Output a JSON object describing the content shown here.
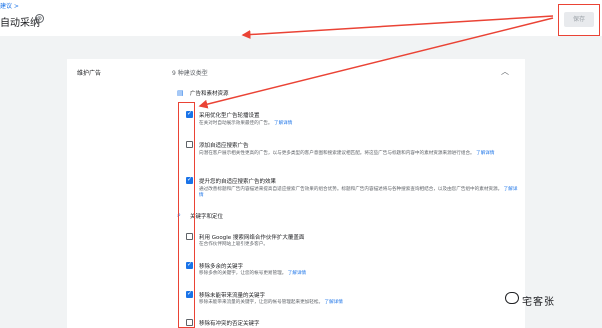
{
  "header": {
    "breadcrumb": "建议 >",
    "title": "自动采纳",
    "close_symbol": "⊗",
    "save_label": "保存"
  },
  "card": {
    "section_label": "维护广告",
    "count_label": "9 种建议类型"
  },
  "groups": [
    {
      "title": "广告和素材资源",
      "icon": "ads-icon"
    },
    {
      "title": "关键字和定位",
      "icon": "search-icon"
    }
  ],
  "items": [
    {
      "checked": true,
      "title": "采用优化型广告轮播设置",
      "desc": "在关对时自动展示效果最佳的广告。",
      "link": "了解详情"
    },
    {
      "checked": false,
      "title": "添加自适应搜索广告",
      "desc": "向潜在客户展示相关性更高的广告，以与更多类型的客户意图和搜索建议相匹配。将这些广告与标题和内容中的素材资源来源进行组合。",
      "link": "了解详情"
    },
    {
      "checked": true,
      "title": "提升您的自适应搜索广告的效果",
      "desc": "通过改善标题和广告内容描述来提高自适应搜索广告效果的组合优势。标题和广告内容描述将与各种搜索查询相结合，以及由您广告组中的素材资源。",
      "link": "了解详情"
    },
    {
      "checked": false,
      "title": "利用 Google 搜索网络合作伙伴扩大覆盖面",
      "desc": "在合作伙伴网站上吸引更多客户。",
      "link": "了解详情"
    },
    {
      "checked": true,
      "title": "移除多余的关键字",
      "desc": "移除多余的关键字，让您的帐号更易管理。",
      "link": "了解详情"
    },
    {
      "checked": true,
      "title": "移除未能带来流量的关键字",
      "desc": "移除未能带来流量的关键字，让您的帐号管理起来更加轻松。",
      "link": "了解详情"
    },
    {
      "checked": false,
      "title": "移除有冲突的否定关键字",
      "desc": "",
      "link": ""
    }
  ],
  "watermark": "宅客张"
}
